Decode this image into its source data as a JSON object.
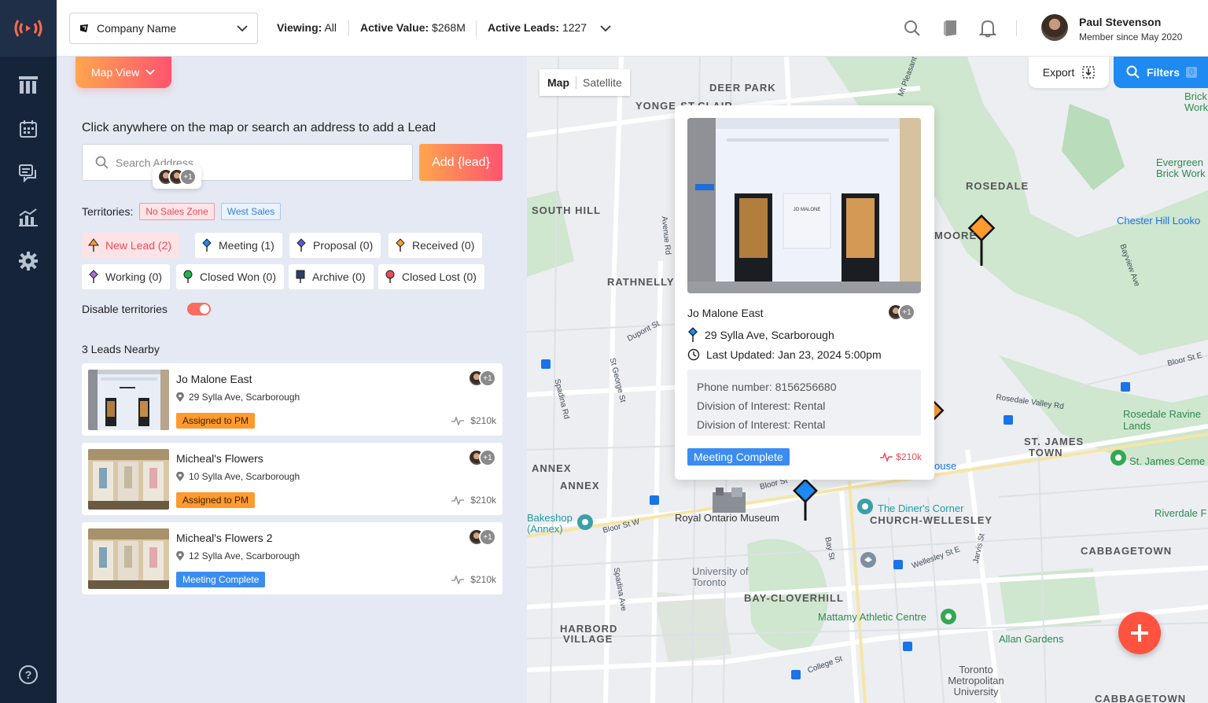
{
  "colors": {
    "accent": "#ff5470",
    "accent_start": "#ffa64d",
    "sidebar": "#16243a",
    "primary": "#1e8af2"
  },
  "header": {
    "company": "Company Name",
    "viewing_label": "Viewing:",
    "viewing_value": "All",
    "active_value_label": "Active Value:",
    "active_value": "$268M",
    "active_leads_label": "Active Leads:",
    "active_leads": "1227",
    "user_name": "Paul Stevenson",
    "user_since": "Member since May 2020"
  },
  "panel": {
    "view_button": "Map View",
    "hint": "Click anywhere on the map or search an address to add a Lead",
    "search_placeholder": "Search Address",
    "add_button": "Add {lead}",
    "avatar_more": "+1",
    "territories_label": "Territories:",
    "territories": [
      "No Sales Zone",
      "West Sales"
    ],
    "statuses": [
      {
        "label": "New Lead (2)",
        "color": "#ff9a2e"
      },
      {
        "label": "Meeting (1)",
        "color": "#1e8af2"
      },
      {
        "label": "Proposal (0)",
        "color": "#5b5bd6"
      },
      {
        "label": "Received (0)",
        "color": "#ff9a2e"
      },
      {
        "label": "Working (0)",
        "color": "#b06ad6"
      },
      {
        "label": "Closed Won (0)",
        "color": "#22b14c"
      },
      {
        "label": "Archive (0)",
        "color": "#2c3e64"
      },
      {
        "label": "Closed Lost (0)",
        "color": "#e84b5a"
      }
    ],
    "disable_territories": "Disable territories",
    "disable_territories_on": true,
    "nearby_title": "3 Leads Nearby",
    "leads": [
      {
        "name": "Jo Malone East",
        "address": "29 Sylla Ave, Scarborough",
        "status": "Assigned to PM",
        "value": "$210k",
        "more": "+1"
      },
      {
        "name": "Micheal's Flowers",
        "address": "10 Sylla Ave, Scarborough",
        "status": "Assigned to PM",
        "value": "$210k",
        "more": "+1"
      },
      {
        "name": "Micheal's Flowers 2",
        "address": "12 Sylla Ave, Scarborough",
        "status": "Meeting Complete",
        "value": "$210k",
        "more": "+1"
      }
    ]
  },
  "map": {
    "type_map": "Map",
    "type_satellite": "Satellite",
    "export": "Export",
    "filters": "Filters",
    "filters_count": "0",
    "labels": [
      "DEER PARK",
      "YONGE-ST.CLAIR",
      "ROSEDALE",
      "SOUTH HILL",
      "MOORE",
      "RATHNELLY",
      "ANNEX",
      "ANNEX",
      "ST. JAMES",
      "TOWN",
      "CABBAGETOWN",
      "BAY-CLOVERHILL",
      "HARBORD",
      "VILLAGE",
      "CHURCH-WELLESLEY",
      "CABBAGETOWN"
    ],
    "places": [
      "Royal Ontario Museum",
      "University of Toronto",
      "Mattamy Athletic Centre",
      "Allan Gardens",
      "The Diner's Corner",
      "Rosedale Ravine Lands",
      "St. James Ceme",
      "Riverdale F",
      "Chester Hill Looko",
      "Evergreen Brick Work",
      "Bakeshop (Annex)",
      "Toronto Metropolitan University",
      "ouse",
      "Brick Works"
    ],
    "streets": [
      "Bloor St W",
      "Bloor St",
      "Dupont St",
      "Spadina Rd",
      "St George St",
      "Avenue Rd",
      "Bay St",
      "Jarvis St",
      "Wellesley St E",
      "College St",
      "Spadina Ave",
      "Rosedale Valley Rd",
      "Bayview Ave",
      "Bloor St E",
      "Mt Pleasant"
    ],
    "popup": {
      "name": "Jo Malone East",
      "address": "29 Sylla Ave, Scarborough",
      "updated": "Last Updated: Jan 23, 2024 5:00pm",
      "phone": "Phone number: 8156256680",
      "division1": "Division of Interest: Rental",
      "division2": "Division of Interest: Rental",
      "status": "Meeting Complete",
      "value": "$210k",
      "more": "+1",
      "sign": "JO MALONE"
    }
  }
}
